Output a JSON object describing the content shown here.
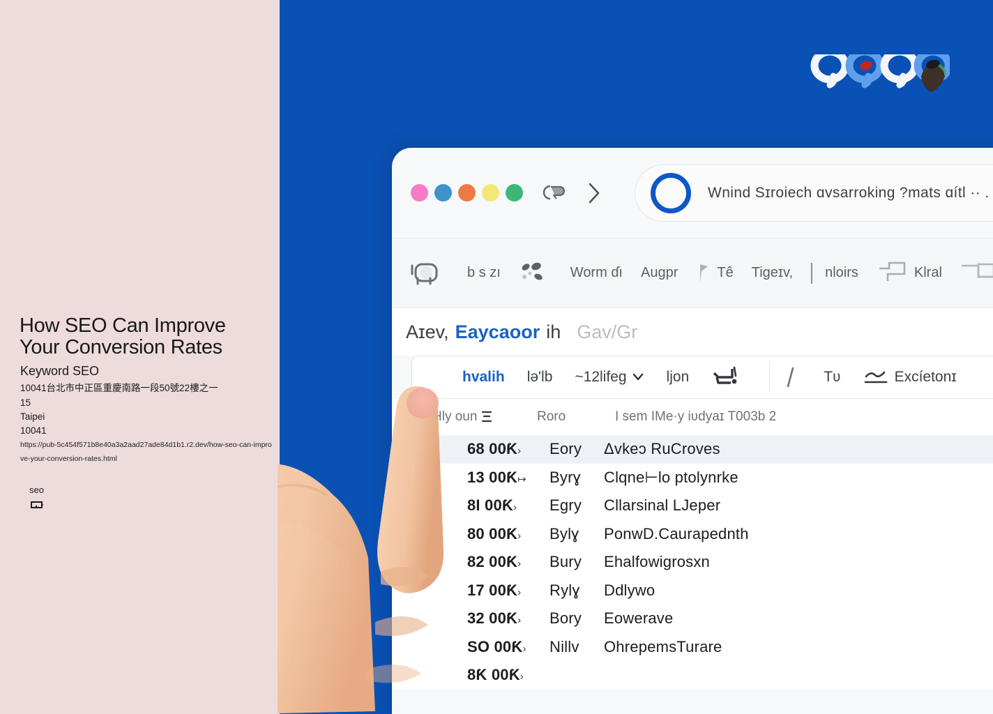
{
  "colors": {
    "left_panel_bg": "#eedcdc",
    "page_bg": "#0a51b5",
    "accent_blue": "#1a62c4",
    "ring_blue": "#0d57c8",
    "row_highlight": "#eef2f7"
  },
  "article": {
    "title": "How SEO Can Improve Your Conversion Rates",
    "subtitle": "Keyword SEO",
    "address": "10041台北市中正區重慶南路一段50號22樓之一",
    "number": "15",
    "city": "Taipei",
    "zip": "10041",
    "url": "https://pub-5c454f571b8e40a3a2aad27ade84d1b1.r2.dev/how-seo-can-improve-your-conversion-rates.html",
    "tag_label": "seo",
    "tag_icon": "tag-icon"
  },
  "logo": {
    "name": "brand-logo",
    "shapes": [
      "ring-white",
      "ring-blue-red",
      "ring-white",
      "ring-blue-green"
    ]
  },
  "browser": {
    "window_dots": [
      {
        "name": "window-dot-pink",
        "color": "#f77cc4"
      },
      {
        "name": "window-dot-blue",
        "color": "#3f93c9"
      },
      {
        "name": "window-dot-orange",
        "color": "#ee7a43"
      },
      {
        "name": "window-dot-yellow",
        "color": "#f2e876"
      },
      {
        "name": "window-dot-green",
        "color": "#3bb877"
      }
    ],
    "nav": {
      "history_icon": "history-bubble-icon",
      "forward_icon": "chevron-right-icon"
    },
    "omnibox": {
      "ring_icon": "search-ring-icon",
      "value": "Wnind Sɪroiech ɑvsarroking ?mats ɑítl  ··  ."
    },
    "toolbar": [
      {
        "name": "toolbar-item-grid",
        "icon": "rounded-square-icon",
        "label": ""
      },
      {
        "name": "toolbar-item-bszi",
        "icon": "",
        "label": "b s zı"
      },
      {
        "name": "toolbar-item-scatter",
        "icon": "scatter-dots-icon",
        "label": ""
      },
      {
        "name": "toolbar-item-wormdi",
        "icon": "",
        "label": "Worm ɗı"
      },
      {
        "name": "toolbar-item-augpr",
        "icon": "",
        "label": "Augpr"
      },
      {
        "name": "toolbar-item-te",
        "icon": "flag-icon",
        "label": "Tê"
      },
      {
        "name": "toolbar-item-tigeiv",
        "icon": "",
        "label": "Tigeɪv,"
      },
      {
        "name": "toolbar-item-nloirs",
        "icon": "",
        "label": "nloirs"
      },
      {
        "name": "toolbar-item-klral",
        "icon": "bracket-icon",
        "label": "Klral"
      },
      {
        "name": "toolbar-item-end",
        "icon": "rect-icon",
        "label": ""
      }
    ],
    "headline": {
      "prefix": "Aɪev,",
      "emphasis": "Eaycaoor",
      "suffix": "ih",
      "muted": "Gav/Gr"
    },
    "filters": [
      {
        "name": "filter-hvalih",
        "label": "hvalih",
        "style": "blue",
        "icon": ""
      },
      {
        "name": "filter-lelb",
        "label": "lə'lb",
        "style": "plain",
        "icon": ""
      },
      {
        "name": "filter-12lifeg",
        "label": "~12lifeg",
        "style": "plain",
        "icon": "chevron-down-icon"
      },
      {
        "name": "filter-ljon",
        "label": "ljon",
        "style": "plain",
        "icon": ""
      },
      {
        "name": "filter-cart",
        "label": "",
        "style": "plain",
        "icon": "cart-icon"
      },
      {
        "name": "filter-slash",
        "label": "",
        "style": "plain",
        "icon": "slash-icon"
      },
      {
        "name": "filter-tv",
        "label": "Tʋ",
        "style": "plain",
        "icon": ""
      },
      {
        "name": "filter-excieton",
        "label": "Excíetonɪ",
        "style": "plain",
        "icon": "underline-arrow-icon"
      }
    ],
    "table": {
      "headers": [
        {
          "name": "column-header-hly-oun",
          "label": "Hly oun",
          "icon": "sort-icon"
        },
        {
          "name": "column-header-roro",
          "label": "Roro",
          "icon": ""
        },
        {
          "name": "column-header-long",
          "label": "I sem IMe·y iʋdyaɪ T003b 2",
          "icon": ""
        }
      ],
      "rows": [
        {
          "metric": "68 00Ƙ",
          "arrow": "›",
          "tag": "Eory",
          "desc": "Δvkeɔ  RuCroves",
          "highlight": true
        },
        {
          "metric": "13 00Ƙ",
          "arrow": "↦",
          "tag": "Byrɣ",
          "desc": "Clqne⊢lo ptolynrke",
          "highlight": false
        },
        {
          "metric": "8I  00Ƙ",
          "arrow": "›",
          "tag": "Egry",
          "desc": "Cllarsinal LJeper",
          "highlight": false
        },
        {
          "metric": "80 00Ƙ",
          "arrow": "›",
          "tag": "Bylɣ",
          "desc": "PonwD.Caurapednth",
          "highlight": false
        },
        {
          "metric": "82 00Ƙ",
          "arrow": "›",
          "tag": "Bury",
          "desc": "Ehalfowigrosxn",
          "highlight": false
        },
        {
          "metric": "17 00Ƙ",
          "arrow": "›",
          "tag": "Rylɣ",
          "desc": "Ddlywo",
          "highlight": false
        },
        {
          "metric": "32 00Ƙ",
          "arrow": "›",
          "tag": "Bory",
          "desc": "Eowerave",
          "highlight": false
        },
        {
          "metric": "SO 00Ƙ",
          "arrow": "›",
          "tag": "Nillv",
          "desc": "OhrepemsTurare",
          "highlight": false
        },
        {
          "metric": "8Ƙ 00Ƙ",
          "arrow": "›",
          "tag": "",
          "desc": "",
          "highlight": false
        }
      ]
    }
  },
  "hand": {
    "name": "pointing-hand-image"
  }
}
